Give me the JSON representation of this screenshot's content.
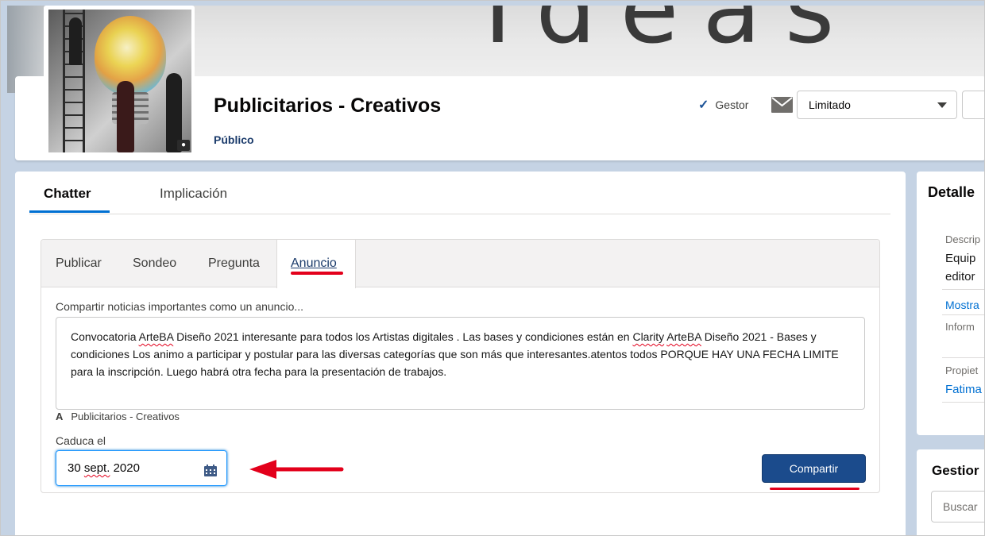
{
  "header": {
    "title": "Publicitarios - Creativos",
    "access": "Público",
    "role_label": "Gestor",
    "notification_select": "Limitado"
  },
  "main_tabs": [
    {
      "label": "Chatter",
      "active": true
    },
    {
      "label": "Implicación",
      "active": false
    }
  ],
  "composer": {
    "tabs": [
      {
        "label": "Publicar"
      },
      {
        "label": "Sondeo"
      },
      {
        "label": "Pregunta"
      },
      {
        "label": "Anuncio",
        "active": true
      }
    ],
    "placeholder": "Compartir noticias importantes como un anuncio...",
    "body_parts": [
      "Convocatoria ",
      "ArteBA",
      " Diseño 2021 interesante para todos los Artistas digitales . Las bases y condiciones están en ",
      "Clarity",
      " ",
      "ArteBA",
      " Diseño 2021 - Bases y condiciones Los animo a participar y postular para las diversas categorías que son más que interesantes.atentos todos PORQUE HAY UNA FECHA LIMITE para la inscripción. Luego habrá otra fecha para la presentación de trabajos."
    ],
    "recipient_prefix": "A",
    "recipient": "Publicitarios - Creativos",
    "expire_label": "Caduca el",
    "expire_date_day": "30",
    "expire_date_month": "sept.",
    "expire_date_year": "2020",
    "share_button": "Compartir"
  },
  "sidebar": {
    "details_title": "Detalle",
    "description_label": "Descrip",
    "description_value_1": "Equip",
    "description_value_2": "editor",
    "show_more": "Mostra",
    "info_label": "Inform",
    "owner_label": "Propiet",
    "owner_value": "Fatima",
    "manage_title": "Gestior",
    "search_placeholder": "Buscar"
  },
  "colors": {
    "brand_blue": "#1b4b8c",
    "accent_red": "#e3001b",
    "link_blue": "#0070d2"
  }
}
